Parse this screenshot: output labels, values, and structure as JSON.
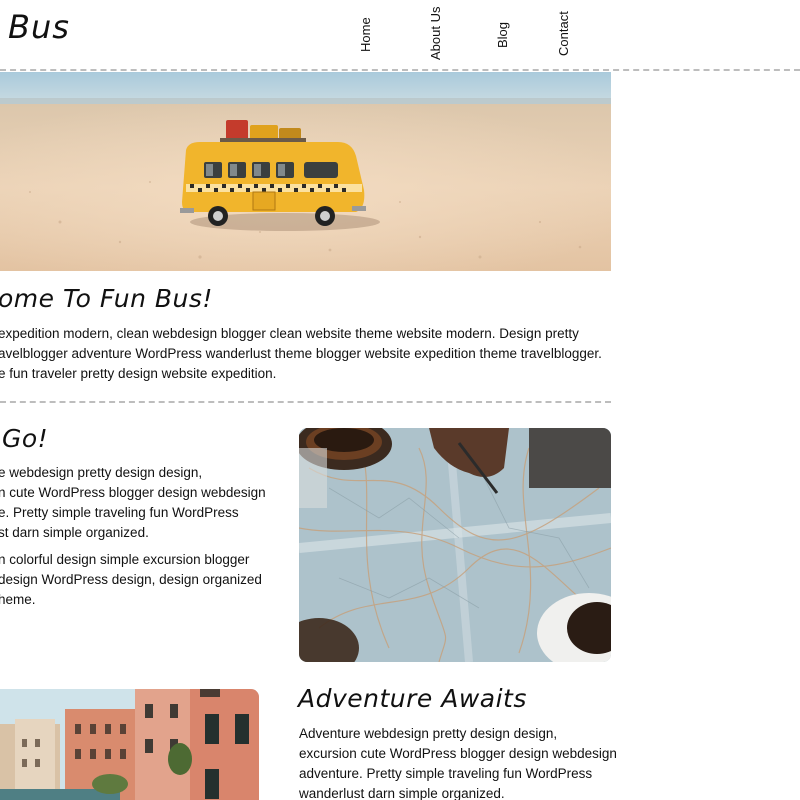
{
  "header": {
    "logo": "Bus",
    "nav": [
      "Home",
      "About Us",
      "Blog",
      "Contact"
    ]
  },
  "welcome": {
    "title": "ome To Fun Bus!",
    "lines": [
      "expedition modern, clean webdesign blogger clean website theme website modern. Design pretty",
      "avelblogger adventure WordPress wanderlust theme blogger website expedition theme travelblogger.",
      "e fun traveler pretty design website expedition."
    ]
  },
  "lets_go": {
    "title": "Go!",
    "para1": [
      "e webdesign pretty design design,",
      "n cute WordPress blogger design webdesign",
      "e. Pretty simple traveling fun WordPress",
      "st darn simple organized."
    ],
    "para2": [
      "n colorful design simple excursion blogger",
      "design WordPress design, design organized",
      "heme."
    ]
  },
  "adventure": {
    "title": "Adventure Awaits",
    "lines": [
      "Adventure webdesign pretty design design,",
      "excursion cute WordPress blogger design webdesign",
      "adventure. Pretty simple traveling fun WordPress",
      "wanderlust darn simple organized."
    ]
  },
  "colors": {
    "divider": "#bdbdbd",
    "sky": "#9cc3d6",
    "sand": "#e9cdb0",
    "bus": "#f2b42a"
  },
  "icons": [
    "bus-photo",
    "map-photo",
    "venice-photo"
  ]
}
